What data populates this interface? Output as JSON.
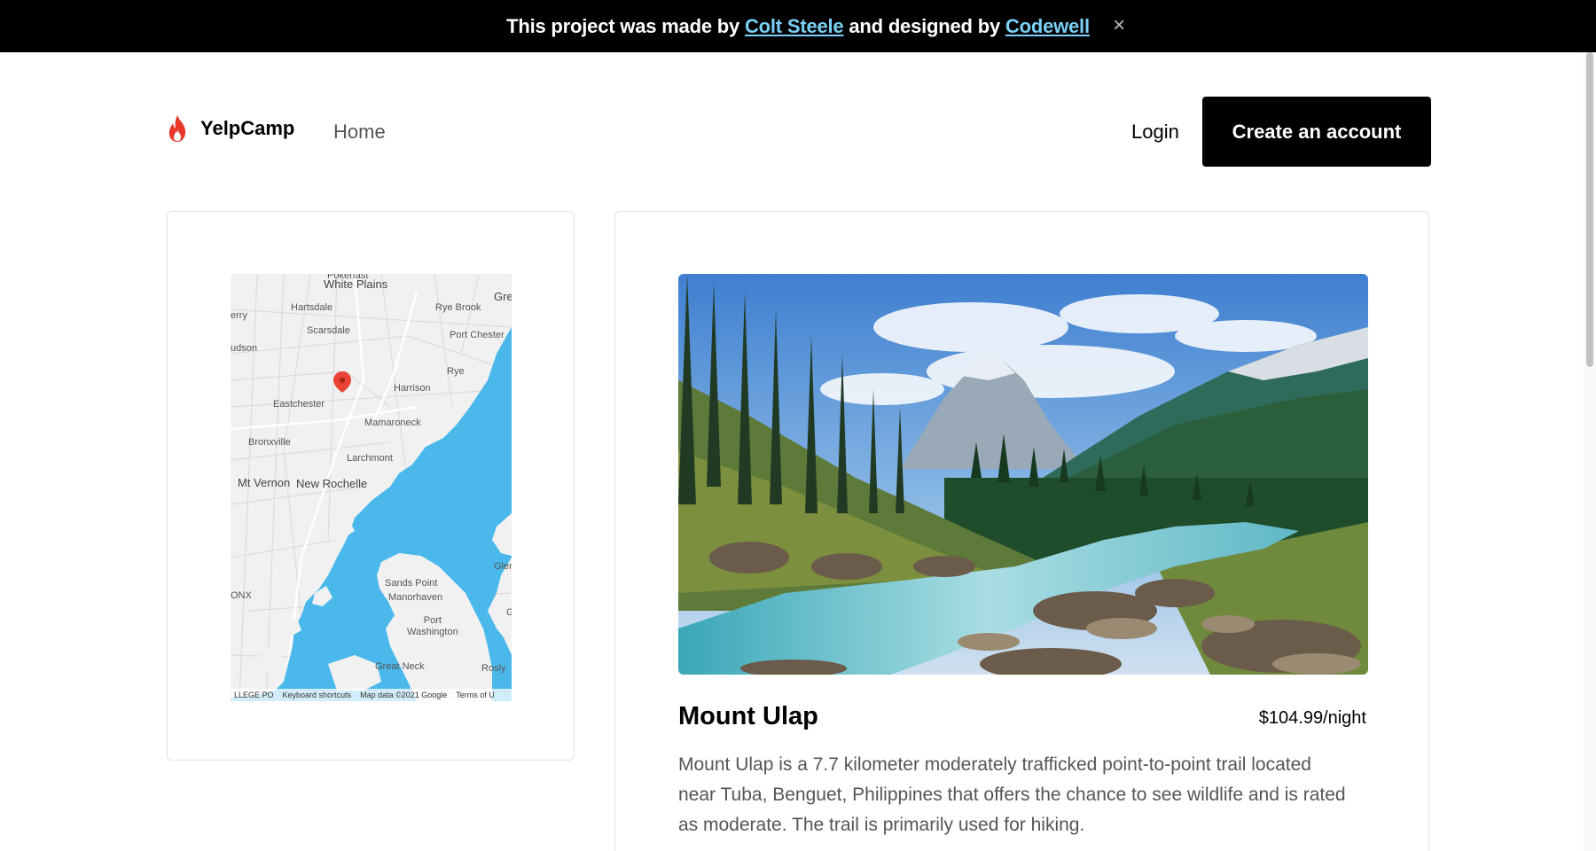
{
  "banner": {
    "prefix": "This project was made by",
    "author": "Colt Steele",
    "middle": "and designed by",
    "designer": "Codewell",
    "close_icon": "close-icon"
  },
  "nav": {
    "brand": "YelpCamp",
    "brand_icon": "flame-icon",
    "home": "Home",
    "login": "Login",
    "create_account": "Create an account"
  },
  "map": {
    "labels": {
      "pokerfast": "Pokerfast",
      "white_plains": "White Plains",
      "gre": "Gre",
      "hartsdale": "Hartsdale",
      "rye_brook": "Rye Brook",
      "erry": "erry",
      "scarsdale": "Scarsdale",
      "port_chester": "Port Chester",
      "udson": "udson",
      "rye": "Rye",
      "harrison": "Harrison",
      "eastchester": "Eastchester",
      "mamaroneck": "Mamaroneck",
      "bronxville": "Bronxville",
      "larchmont": "Larchmont",
      "mt_vernon": "Mt Vernon",
      "new_rochelle": "New Rochelle",
      "glen": "Glen",
      "sands_point": "Sands Point",
      "manorhaven": "Manorhaven",
      "onx": "ONX",
      "port_washington": "Port\nWashington",
      "g": "G",
      "great_neck": "Great Neck",
      "rosly": "Rosly"
    },
    "footer": {
      "google": "LLEGE PO",
      "shortcuts": "Keyboard shortcuts",
      "map_data": "Map data ©2021 Google",
      "terms": "Terms of U"
    },
    "marker_icon": "map-pin-icon"
  },
  "campground": {
    "title": "Mount Ulap",
    "price": "$104.99/night",
    "description": "Mount Ulap is a 7.7 kilometer moderately trafficked point-to-point trail located near Tuba, Benguet, Philippines that offers the chance to see wildlife and is rated as moderate. The trail is primarily used for hiking."
  },
  "colors": {
    "banner_bg": "#000000",
    "link": "#7ad0f5",
    "water": "#4bb8ec",
    "accent_flame": "#e8392b"
  }
}
